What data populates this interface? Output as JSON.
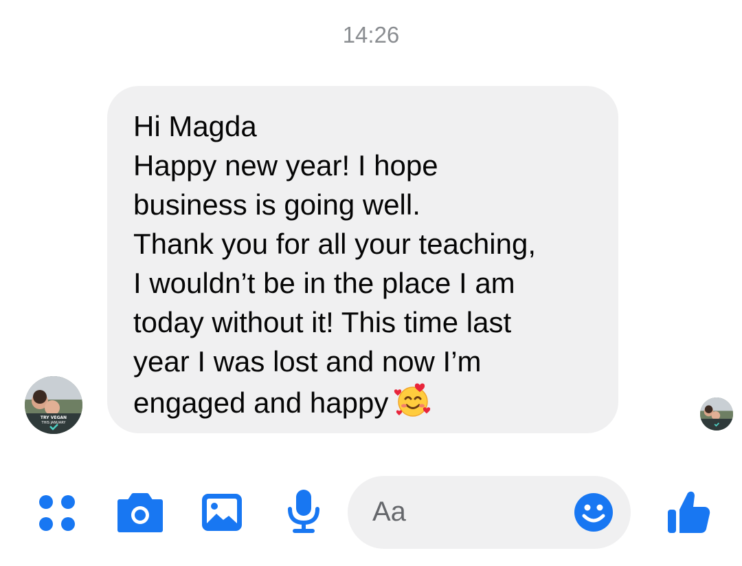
{
  "timestamp": "14:26",
  "message": {
    "lines": [
      "Hi Magda",
      "Happy new year! I hope",
      "business is going well.",
      "Thank you for all your teaching,",
      "I wouldn’t be in the place I am",
      "today without it! This time last",
      "year I was lost and now I’m",
      "engaged and happy"
    ],
    "emoji": "smiling-face-with-hearts"
  },
  "avatar": {
    "badge_line1": "TRY VEGAN",
    "badge_line2": "THIS JANUARY"
  },
  "composer": {
    "placeholder": "Aa",
    "icons": [
      "menu-dots-icon",
      "camera-icon",
      "image-icon",
      "microphone-icon",
      "emoji-icon",
      "thumbs-up-icon"
    ],
    "accent_color": "#1877f2"
  }
}
